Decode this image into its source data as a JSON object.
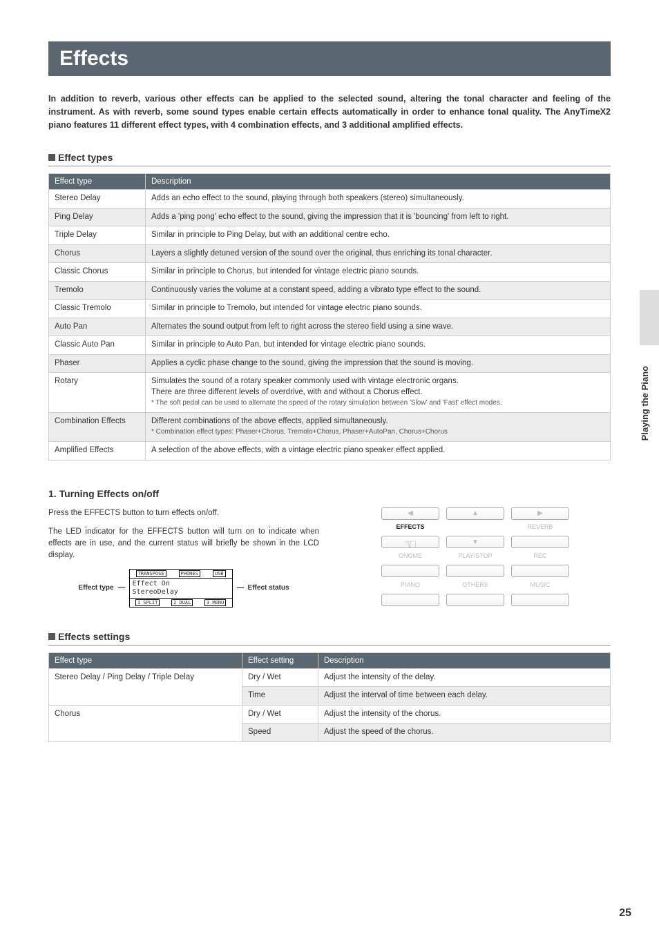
{
  "title": "Effects",
  "intro": "In addition to reverb, various other effects can be applied to the selected sound, altering the tonal character and feeling of the instrument.  As with reverb, some sound types enable certain effects automatically in order to enhance tonal quality.  The AnyTimeX2 piano features 11 different effect types, with 4 combination effects, and 3 additional amplified effects.",
  "sections": {
    "effect_types_heading": "Effect types",
    "turning_heading": "1. Turning Effects on/off",
    "settings_heading": "Effects settings"
  },
  "effect_table": {
    "headers": [
      "Effect type",
      "Description"
    ],
    "rows": [
      {
        "name": "Stereo Delay",
        "desc": "Adds an echo effect to the sound, playing through both speakers (stereo) simultaneously."
      },
      {
        "name": "Ping Delay",
        "desc": "Adds a 'ping pong' echo effect to the sound, giving the impression that it is 'bouncing' from left to right."
      },
      {
        "name": "Triple Delay",
        "desc": "Similar in principle to Ping Delay, but with an additional centre echo."
      },
      {
        "name": "Chorus",
        "desc": "Layers a slightly detuned version of the sound over the original, thus enriching its tonal character."
      },
      {
        "name": "Classic Chorus",
        "desc": "Similar in principle to Chorus, but intended for vintage electric piano sounds."
      },
      {
        "name": "Tremolo",
        "desc": "Continuously varies the volume at a constant speed, adding a vibrato type effect to the sound."
      },
      {
        "name": "Classic Tremolo",
        "desc": "Similar in principle to Tremolo, but intended for vintage electric piano sounds."
      },
      {
        "name": "Auto Pan",
        "desc": "Alternates the sound output from left to right across the stereo field using a sine wave."
      },
      {
        "name": "Classic Auto Pan",
        "desc": "Similar in principle to Auto Pan, but intended for vintage electric piano sounds."
      },
      {
        "name": "Phaser",
        "desc": "Applies a cyclic phase change to the sound, giving the impression that the sound is moving."
      },
      {
        "name": "Rotary",
        "desc": "Simulates the sound of a rotary speaker commonly used with vintage electronic organs.\nThere are three different levels of overdrive, with and without a Chorus effect.",
        "note": "* The soft pedal can be used to alternate the speed of the rotary simulation between 'Slow' and 'Fast' effect modes."
      },
      {
        "name": "Combination Effects",
        "desc": "Different combinations of the above effects, applied simultaneously.",
        "note": "* Combination effect types: Phaser+Chorus, Tremolo+Chorus, Phaser+AutoPan, Chorus+Chorus"
      },
      {
        "name": "Amplified Effects",
        "desc": "A selection of the above effects, with a vintage electric piano speaker effect applied."
      }
    ]
  },
  "turning": {
    "p1": "Press the EFFECTS button to turn effects on/off.",
    "p2": "The LED indicator for the EFFECTS button will turn on to indicate when effects are in use, and the current status will briefly be shown in the LCD display.",
    "lcd": {
      "top": [
        "TRANSPOSE",
        "PHONES",
        "USB"
      ],
      "line1": "Effect     On",
      "line2": " StereoDelay",
      "bot": [
        "1 SPLIT",
        "2 DUAL",
        "3 MENU"
      ]
    },
    "lcd_left_label": "Effect type",
    "lcd_right_label": "Effect status",
    "panel": {
      "row1_arrows": [
        "◀",
        "▲",
        "▶"
      ],
      "row1_labels": [
        "EFFECTS",
        "",
        "REVERB"
      ],
      "row2_arrows": [
        "",
        "▼",
        ""
      ],
      "row2_labels": [
        "ONOME",
        "PLAY/STOP",
        "REC"
      ],
      "row3_labels": [
        "PIANO",
        "OTHERS",
        "MUSIC"
      ]
    }
  },
  "settings_table": {
    "headers": [
      "Effect type",
      "Effect setting",
      "Description"
    ],
    "rows": [
      {
        "type": "Stereo Delay / Ping Delay / Triple Delay",
        "setting": "Dry / Wet",
        "desc": "Adjust the intensity of the delay.",
        "alt": false
      },
      {
        "type": "",
        "setting": "Time",
        "desc": "Adjust the interval of time between each delay.",
        "alt": true
      },
      {
        "type": "Chorus",
        "setting": "Dry / Wet",
        "desc": "Adjust the intensity of the chorus.",
        "alt": false
      },
      {
        "type": "",
        "setting": "Speed",
        "desc": "Adjust the speed of the chorus.",
        "alt": true
      }
    ]
  },
  "side_label": "Playing the Piano",
  "page_number": "25"
}
